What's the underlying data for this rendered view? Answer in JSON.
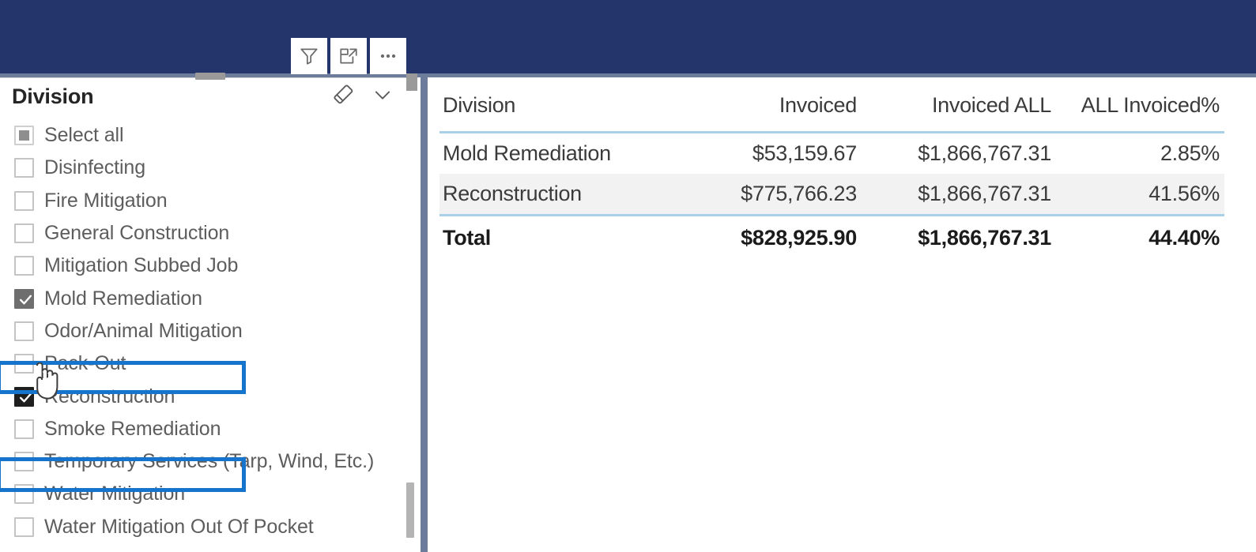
{
  "banner": {
    "color": "#24356b",
    "underline_color": "#6d7c9b"
  },
  "visual_toolbar": {
    "buttons": [
      {
        "name": "filter-icon",
        "label": "Filters"
      },
      {
        "name": "focus-mode-icon",
        "label": "Focus mode"
      },
      {
        "name": "more-options-icon",
        "label": "More options"
      }
    ]
  },
  "slicer": {
    "title": "Division",
    "actions": [
      {
        "name": "clear-selections-icon",
        "label": "Clear selections"
      },
      {
        "name": "dropdown-chevron-icon",
        "label": "Open dropdown"
      }
    ],
    "items": [
      {
        "label": "Select all",
        "state": "partial"
      },
      {
        "label": "Disinfecting",
        "state": "unchecked"
      },
      {
        "label": "Fire Mitigation",
        "state": "unchecked"
      },
      {
        "label": "General Construction",
        "state": "unchecked"
      },
      {
        "label": "Mitigation Subbed Job",
        "state": "unchecked"
      },
      {
        "label": "Mold Remediation",
        "state": "checked-hover"
      },
      {
        "label": "Odor/Animal Mitigation",
        "state": "unchecked"
      },
      {
        "label": "Pack-Out",
        "state": "unchecked"
      },
      {
        "label": "Reconstruction",
        "state": "checked"
      },
      {
        "label": "Smoke Remediation",
        "state": "unchecked"
      },
      {
        "label": "Temporary Services (Tarp, Wind, Etc.)",
        "state": "unchecked"
      },
      {
        "label": "Water Mitigation",
        "state": "unchecked"
      },
      {
        "label": "Water Mitigation Out Of Pocket",
        "state": "unchecked"
      }
    ],
    "highlight_color": "#1574cb",
    "highlighted_items": [
      "Mold Remediation",
      "Reconstruction"
    ]
  },
  "chart_data": {
    "type": "table",
    "title": "",
    "columns": [
      "Division",
      "Invoiced",
      "Invoiced ALL",
      "ALL Invoiced%"
    ],
    "rows": [
      {
        "division": "Mold Remediation",
        "invoiced": "$53,159.67",
        "invoiced_all": "$1,866,767.31",
        "all_invoiced_pct": "2.85%"
      },
      {
        "division": "Reconstruction",
        "invoiced": "$775,766.23",
        "invoiced_all": "$1,866,767.31",
        "all_invoiced_pct": "41.56%"
      }
    ],
    "total": {
      "division": "Total",
      "invoiced": "$828,925.90",
      "invoiced_all": "$1,866,767.31",
      "all_invoiced_pct": "44.40%"
    },
    "values": [
      53159.67,
      775766.23
    ],
    "categories": [
      "Mold Remediation",
      "Reconstruction"
    ],
    "series": [
      {
        "name": "Invoiced",
        "values": [
          53159.67,
          775766.23
        ]
      },
      {
        "name": "Invoiced ALL",
        "values": [
          1866767.31,
          1866767.31
        ]
      },
      {
        "name": "ALL Invoiced%",
        "values": [
          2.85,
          41.56
        ]
      }
    ],
    "total_values": {
      "Invoiced": 828925.9,
      "Invoiced ALL": 1866767.31,
      "ALL Invoiced%": 44.4
    },
    "grid": false,
    "legend_position": "none"
  }
}
